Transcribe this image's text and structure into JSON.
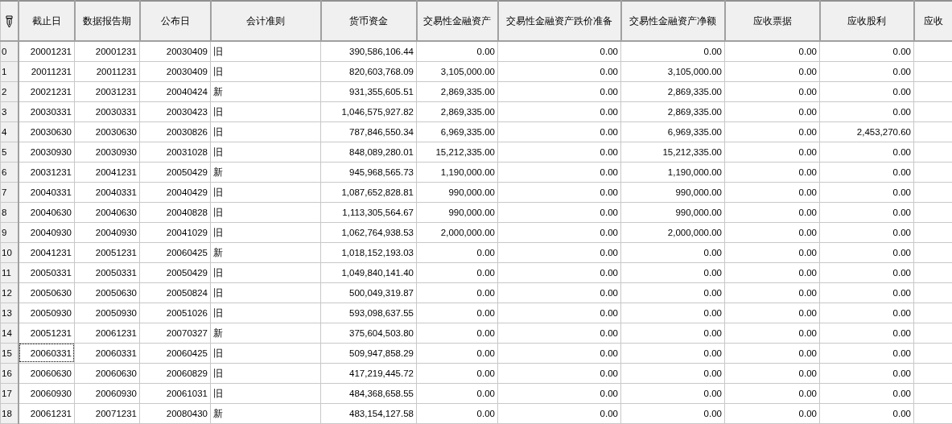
{
  "table": {
    "columns": [
      "截止日",
      "数据报告期",
      "公布日",
      "会计准则",
      "货币资金",
      "交易性金融资产",
      "交易性金融资产跌价准备",
      "交易性金融资产净额",
      "应收票据",
      "应收股利",
      "应收"
    ],
    "rows": [
      {
        "index": "0",
        "focused": false,
        "cells": [
          "20001231",
          "20001231",
          "20030409",
          "旧",
          "390,586,106.44",
          "0.00",
          "0.00",
          "0.00",
          "0.00",
          "0.00"
        ]
      },
      {
        "index": "1",
        "focused": false,
        "cells": [
          "20011231",
          "20011231",
          "20030409",
          "旧",
          "820,603,768.09",
          "3,105,000.00",
          "0.00",
          "3,105,000.00",
          "0.00",
          "0.00"
        ]
      },
      {
        "index": "2",
        "focused": false,
        "cells": [
          "20021231",
          "20031231",
          "20040424",
          "新",
          "931,355,605.51",
          "2,869,335.00",
          "0.00",
          "2,869,335.00",
          "0.00",
          "0.00"
        ]
      },
      {
        "index": "3",
        "focused": false,
        "cells": [
          "20030331",
          "20030331",
          "20030423",
          "旧",
          "1,046,575,927.82",
          "2,869,335.00",
          "0.00",
          "2,869,335.00",
          "0.00",
          "0.00"
        ]
      },
      {
        "index": "4",
        "focused": false,
        "cells": [
          "20030630",
          "20030630",
          "20030826",
          "旧",
          "787,846,550.34",
          "6,969,335.00",
          "0.00",
          "6,969,335.00",
          "0.00",
          "2,453,270.60"
        ]
      },
      {
        "index": "5",
        "focused": false,
        "cells": [
          "20030930",
          "20030930",
          "20031028",
          "旧",
          "848,089,280.01",
          "15,212,335.00",
          "0.00",
          "15,212,335.00",
          "0.00",
          "0.00"
        ]
      },
      {
        "index": "6",
        "focused": false,
        "cells": [
          "20031231",
          "20041231",
          "20050429",
          "新",
          "945,968,565.73",
          "1,190,000.00",
          "0.00",
          "1,190,000.00",
          "0.00",
          "0.00"
        ]
      },
      {
        "index": "7",
        "focused": false,
        "cells": [
          "20040331",
          "20040331",
          "20040429",
          "旧",
          "1,087,652,828.81",
          "990,000.00",
          "0.00",
          "990,000.00",
          "0.00",
          "0.00"
        ]
      },
      {
        "index": "8",
        "focused": false,
        "cells": [
          "20040630",
          "20040630",
          "20040828",
          "旧",
          "1,113,305,564.67",
          "990,000.00",
          "0.00",
          "990,000.00",
          "0.00",
          "0.00"
        ]
      },
      {
        "index": "9",
        "focused": false,
        "cells": [
          "20040930",
          "20040930",
          "20041029",
          "旧",
          "1,062,764,938.53",
          "2,000,000.00",
          "0.00",
          "2,000,000.00",
          "0.00",
          "0.00"
        ]
      },
      {
        "index": "10",
        "focused": false,
        "cells": [
          "20041231",
          "20051231",
          "20060425",
          "新",
          "1,018,152,193.03",
          "0.00",
          "0.00",
          "0.00",
          "0.00",
          "0.00"
        ]
      },
      {
        "index": "11",
        "focused": false,
        "cells": [
          "20050331",
          "20050331",
          "20050429",
          "旧",
          "1,049,840,141.40",
          "0.00",
          "0.00",
          "0.00",
          "0.00",
          "0.00"
        ]
      },
      {
        "index": "12",
        "focused": false,
        "cells": [
          "20050630",
          "20050630",
          "20050824",
          "旧",
          "500,049,319.87",
          "0.00",
          "0.00",
          "0.00",
          "0.00",
          "0.00"
        ]
      },
      {
        "index": "13",
        "focused": false,
        "cells": [
          "20050930",
          "20050930",
          "20051026",
          "旧",
          "593,098,637.55",
          "0.00",
          "0.00",
          "0.00",
          "0.00",
          "0.00"
        ]
      },
      {
        "index": "14",
        "focused": false,
        "cells": [
          "20051231",
          "20061231",
          "20070327",
          "新",
          "375,604,503.80",
          "0.00",
          "0.00",
          "0.00",
          "0.00",
          "0.00"
        ]
      },
      {
        "index": "15",
        "focused": true,
        "cells": [
          "20060331",
          "20060331",
          "20060425",
          "旧",
          "509,947,858.29",
          "0.00",
          "0.00",
          "0.00",
          "0.00",
          "0.00"
        ]
      },
      {
        "index": "16",
        "focused": false,
        "cells": [
          "20060630",
          "20060630",
          "20060829",
          "旧",
          "417,219,445.72",
          "0.00",
          "0.00",
          "0.00",
          "0.00",
          "0.00"
        ]
      },
      {
        "index": "17",
        "focused": false,
        "cells": [
          "20060930",
          "20060930",
          "20061031",
          "旧",
          "484,368,658.55",
          "0.00",
          "0.00",
          "0.00",
          "0.00",
          "0.00"
        ]
      },
      {
        "index": "18",
        "focused": false,
        "cells": [
          "20061231",
          "20071231",
          "20080430",
          "新",
          "483,154,127.58",
          "0.00",
          "0.00",
          "0.00",
          "0.00",
          "0.00"
        ]
      }
    ]
  }
}
